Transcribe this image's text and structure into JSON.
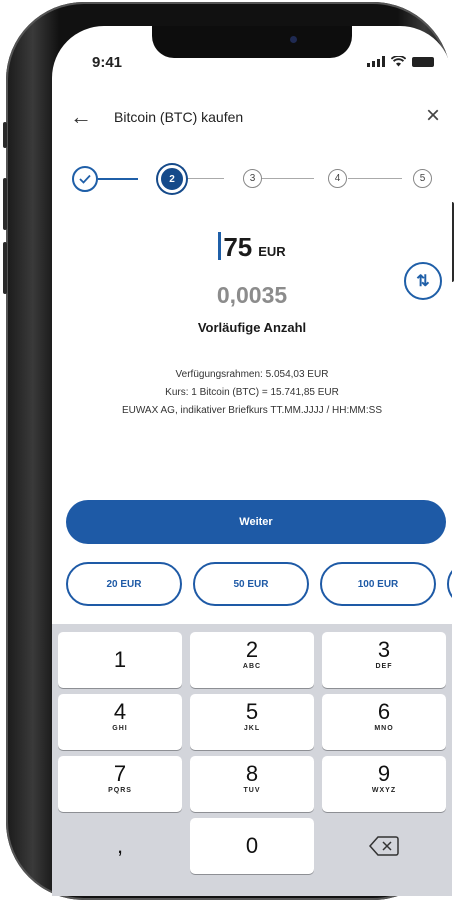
{
  "status_bar": {
    "time": "9:41"
  },
  "header": {
    "back_icon": "arrow-left-icon",
    "title": "Bitcoin (BTC) kaufen",
    "close_icon": "close-icon"
  },
  "stepper": {
    "current": 2,
    "steps": [
      {
        "label": "",
        "state": "done"
      },
      {
        "label": "2",
        "state": "active"
      },
      {
        "label": "3",
        "state": "todo"
      },
      {
        "label": "4",
        "state": "todo"
      },
      {
        "label": "5",
        "state": "todo"
      }
    ]
  },
  "amount": {
    "value": "75",
    "currency": "EUR"
  },
  "quantity": {
    "value": "0,0035",
    "label": "Vorläufige Anzahl"
  },
  "info": {
    "line1": "Verfügungsrahmen: 5.054,03 EUR",
    "line2": "Kurs: 1 Bitcoin (BTC) = 15.741,85 EUR",
    "line3": "EUWAX AG, indikativer Briefkurs TT.MM.JJJJ / HH:MM:SS"
  },
  "primary_button": {
    "label": "Weiter"
  },
  "quick_amounts": [
    "20 EUR",
    "50 EUR",
    "100 EUR",
    ""
  ],
  "keypad": {
    "keys": [
      {
        "n": "1",
        "l": ""
      },
      {
        "n": "2",
        "l": "ABC"
      },
      {
        "n": "3",
        "l": "DEF"
      },
      {
        "n": "4",
        "l": "GHI"
      },
      {
        "n": "5",
        "l": "JKL"
      },
      {
        "n": "6",
        "l": "MNO"
      },
      {
        "n": "7",
        "l": "PQRS"
      },
      {
        "n": "8",
        "l": "TUV"
      },
      {
        "n": "9",
        "l": "WXYZ"
      },
      {
        "n": ",",
        "l": ""
      },
      {
        "n": "0",
        "l": ""
      },
      {
        "n": "",
        "l": ""
      }
    ]
  },
  "colors": {
    "accent": "#1e5aa6",
    "step_active": "#154a8a",
    "muted": "#8c8c8c",
    "keypad_bg": "#d3d5db"
  }
}
